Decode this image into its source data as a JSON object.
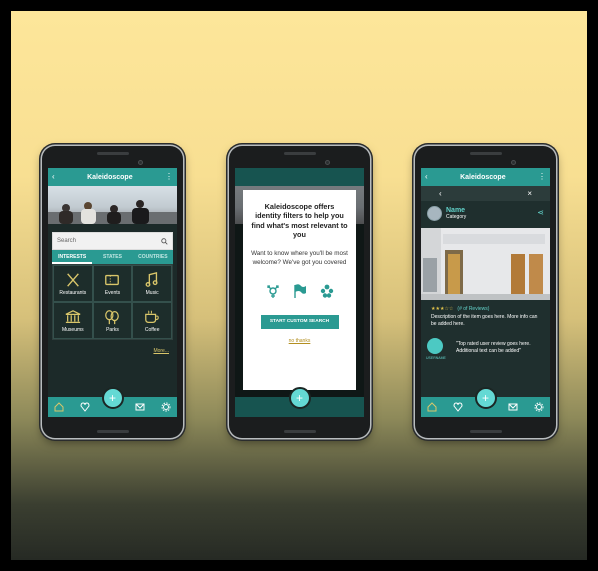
{
  "phone1": {
    "app_title": "Kaleidoscope",
    "search_placeholder": "Search",
    "tabs": [
      "INTERESTS",
      "STATES",
      "COUNTRIES"
    ],
    "categories": [
      {
        "label": "Restaurants",
        "icon": "fork-knife-icon"
      },
      {
        "label": "Events",
        "icon": "ticket-icon"
      },
      {
        "label": "Music",
        "icon": "music-note-icon"
      },
      {
        "label": "Museums",
        "icon": "museum-icon"
      },
      {
        "label": "Parks",
        "icon": "trees-icon"
      },
      {
        "label": "Coffee",
        "icon": "coffee-cup-icon"
      }
    ],
    "more_link": "More...",
    "fab_label": "+"
  },
  "phone2": {
    "modal_title": "Kaleidoscope offers identity filters to help you find what's most relevant to you",
    "modal_body": "Want to know where you'll be most welcome? We've got you covered",
    "modal_icons": [
      "transgender-symbol-icon",
      "flag-icon",
      "accessibility-icon"
    ],
    "cta_label": "START CUSTOM SEARCH",
    "dismiss_label": "no thanks"
  },
  "phone3": {
    "app_title": "Kaleidoscope",
    "item_name": "Name",
    "item_category": "Category",
    "stars_text": "★★★☆☆",
    "review_count": "(# of Reviews)",
    "description": "Description of the item goes here. More info can be added here.",
    "review_text": "\"Top rated user review goes here. Additional text can be added\"",
    "reviewer_name": "USERNAME"
  },
  "colors": {
    "teal": "#2a9a92",
    "teal_light": "#64d9d4",
    "accent_gold": "#d9c66a"
  }
}
